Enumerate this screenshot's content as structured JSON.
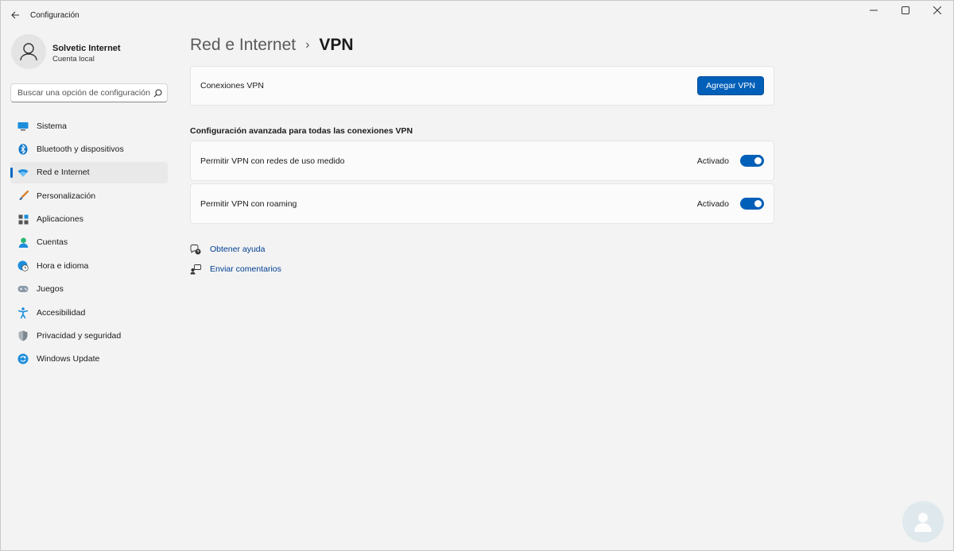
{
  "window": {
    "title": "Configuración",
    "controls": {
      "minimize": "—",
      "maximize": "☐",
      "close": "✕"
    }
  },
  "profile": {
    "name": "Solvetic Internet",
    "account_type": "Cuenta local"
  },
  "search": {
    "placeholder": "Buscar una opción de configuración"
  },
  "sidebar": {
    "items": [
      {
        "label": "Sistema",
        "icon": "monitor-icon",
        "active": false
      },
      {
        "label": "Bluetooth y dispositivos",
        "icon": "bluetooth-icon",
        "active": false
      },
      {
        "label": "Red e Internet",
        "icon": "wifi-icon",
        "active": true
      },
      {
        "label": "Personalización",
        "icon": "brush-icon",
        "active": false
      },
      {
        "label": "Aplicaciones",
        "icon": "apps-icon",
        "active": false
      },
      {
        "label": "Cuentas",
        "icon": "person-icon",
        "active": false
      },
      {
        "label": "Hora e idioma",
        "icon": "globe-clock-icon",
        "active": false
      },
      {
        "label": "Juegos",
        "icon": "gamepad-icon",
        "active": false
      },
      {
        "label": "Accesibilidad",
        "icon": "accessibility-icon",
        "active": false
      },
      {
        "label": "Privacidad y seguridad",
        "icon": "shield-icon",
        "active": false
      },
      {
        "label": "Windows Update",
        "icon": "update-icon",
        "active": false
      }
    ]
  },
  "main": {
    "breadcrumb": {
      "parent": "Red e Internet",
      "separator": "›",
      "current": "VPN"
    },
    "vpn_connections": {
      "label": "Conexiones VPN",
      "button": "Agregar VPN"
    },
    "advanced_title": "Configuración avanzada para todas las conexiones VPN",
    "settings": [
      {
        "label": "Permitir VPN con redes de uso medido",
        "state": "Activado",
        "on": true
      },
      {
        "label": "Permitir VPN con roaming",
        "state": "Activado",
        "on": true
      }
    ],
    "links": [
      {
        "label": "Obtener ayuda",
        "icon": "help-icon"
      },
      {
        "label": "Enviar comentarios",
        "icon": "feedback-icon"
      }
    ]
  },
  "colors": {
    "accent": "#005fb8",
    "link": "#003e92",
    "background": "#f3f3f3",
    "card": "#fbfbfb"
  }
}
